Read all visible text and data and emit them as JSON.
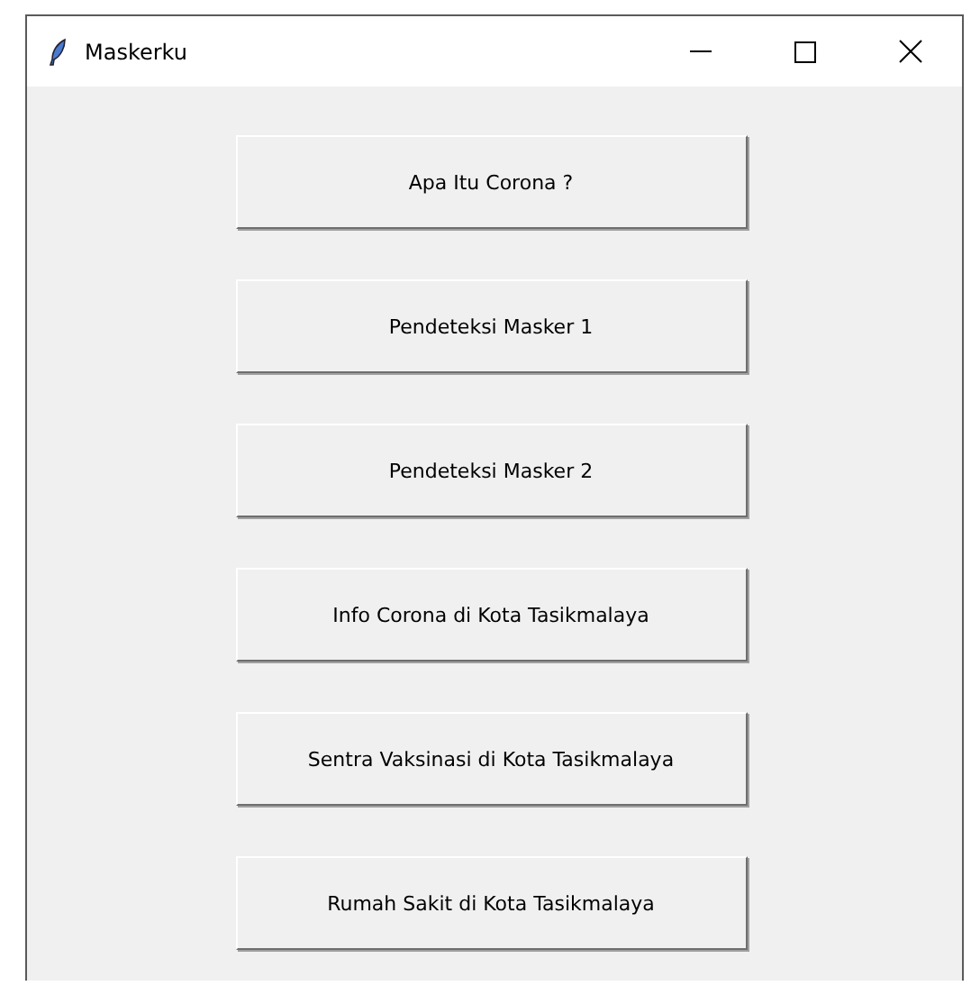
{
  "window": {
    "title": "Maskerku"
  },
  "buttons": [
    {
      "label": "Apa Itu Corona ?"
    },
    {
      "label": "Pendeteksi Masker 1"
    },
    {
      "label": "Pendeteksi Masker 2"
    },
    {
      "label": "Info Corona di Kota Tasikmalaya"
    },
    {
      "label": "Sentra Vaksinasi di Kota Tasikmalaya"
    },
    {
      "label": "Rumah Sakit di Kota Tasikmalaya"
    }
  ]
}
